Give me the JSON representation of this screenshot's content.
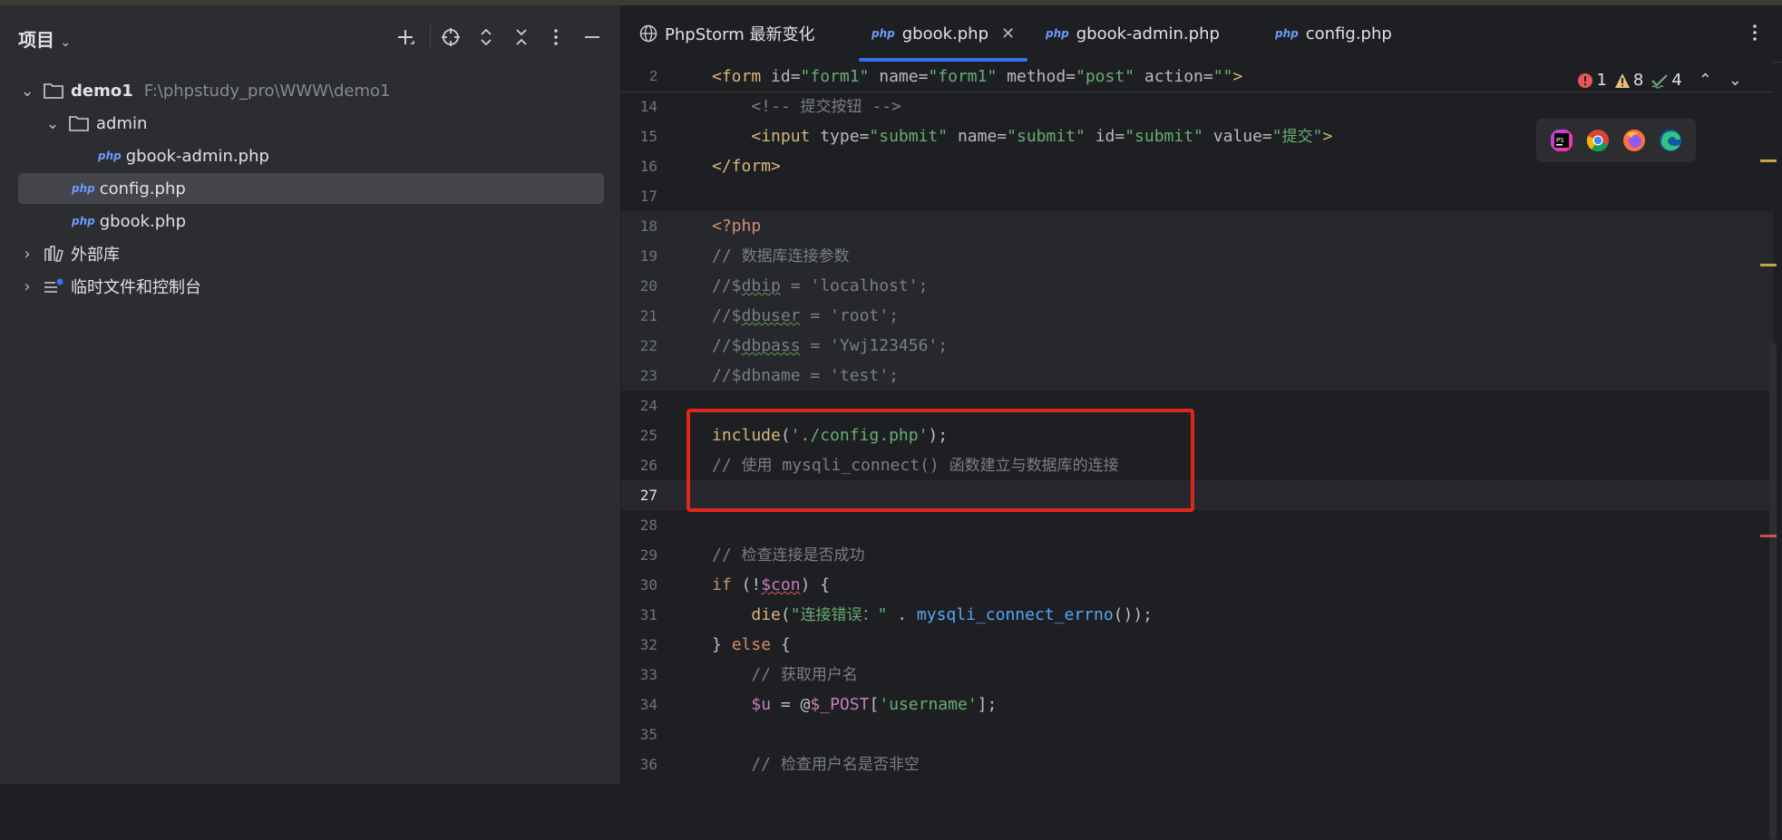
{
  "colors": {
    "accent": "#3574f0",
    "highlight_box": "#e0261b",
    "error": "#e55757",
    "warning": "#e5c07b",
    "ok": "#6aab73"
  },
  "project_panel": {
    "title": "项目",
    "tree": [
      {
        "label": "demo1",
        "path": "F:\\phpstudy_pro\\WWW\\demo1",
        "icon": "folder-icon",
        "expanded": true,
        "level": 0
      },
      {
        "label": "admin",
        "icon": "folder-icon",
        "expanded": true,
        "level": 1
      },
      {
        "label": "gbook-admin.php",
        "icon": "php-file-icon",
        "level": 2
      },
      {
        "label": "config.php",
        "icon": "php-file-icon",
        "level": 1,
        "selected": true
      },
      {
        "label": "gbook.php",
        "icon": "php-file-icon",
        "level": 1
      },
      {
        "label": "外部库",
        "icon": "library-icon",
        "expanded": false,
        "level": 0
      },
      {
        "label": "临时文件和控制台",
        "icon": "scratches-icon",
        "expanded": false,
        "level": 0
      }
    ],
    "php_icon_text": "php"
  },
  "editor": {
    "tabs": [
      {
        "label": "PhpStorm 最新变化",
        "icon": "globe-icon"
      },
      {
        "label": "gbook.php",
        "icon": "php-file-icon",
        "active": true
      },
      {
        "label": "gbook-admin.php",
        "icon": "php-file-icon"
      },
      {
        "label": "config.php",
        "icon": "php-file-icon"
      }
    ],
    "inspections": {
      "errors": "1",
      "warnings": "8",
      "typos": "4"
    },
    "browsers": [
      "phpstorm-icon",
      "chrome-icon",
      "firefox-icon",
      "edge-icon"
    ],
    "sticky_line": {
      "num": "2",
      "text": "<form id=\"form1\" name=\"form1\" method=\"post\" action=\"\">"
    },
    "lines": [
      {
        "num": "14",
        "text": "    <!-- 提交按钮 -->"
      },
      {
        "num": "15",
        "text": "    <input type=\"submit\" name=\"submit\" id=\"submit\" value=\"提交\">"
      },
      {
        "num": "16",
        "text": "</form>"
      },
      {
        "num": "17",
        "text": ""
      },
      {
        "num": "18",
        "text": "<?php"
      },
      {
        "num": "19",
        "text": "// 数据库连接参数"
      },
      {
        "num": "20",
        "text": "//$dbip = 'localhost';"
      },
      {
        "num": "21",
        "text": "//$dbuser = 'root';"
      },
      {
        "num": "22",
        "text": "//$dbpass = 'Ywj123456';"
      },
      {
        "num": "23",
        "text": "//$dbname = 'test';"
      },
      {
        "num": "24",
        "text": ""
      },
      {
        "num": "25",
        "text": "include('./config.php');"
      },
      {
        "num": "26",
        "text": "// 使用 mysqli_connect() 函数建立与数据库的连接"
      },
      {
        "num": "27",
        "text": ""
      },
      {
        "num": "28",
        "text": ""
      },
      {
        "num": "29",
        "text": "// 检查连接是否成功"
      },
      {
        "num": "30",
        "text": "if (!$con) {"
      },
      {
        "num": "31",
        "text": "    die(\"连接错误：\" . mysqli_connect_errno());"
      },
      {
        "num": "32",
        "text": "} else {"
      },
      {
        "num": "33",
        "text": "    // 获取用户名"
      },
      {
        "num": "34",
        "text": "    $u = @$_POST['username'];"
      },
      {
        "num": "35",
        "text": ""
      },
      {
        "num": "36",
        "text": "    // 检查用户名是否非空"
      }
    ],
    "current_line": "27"
  }
}
